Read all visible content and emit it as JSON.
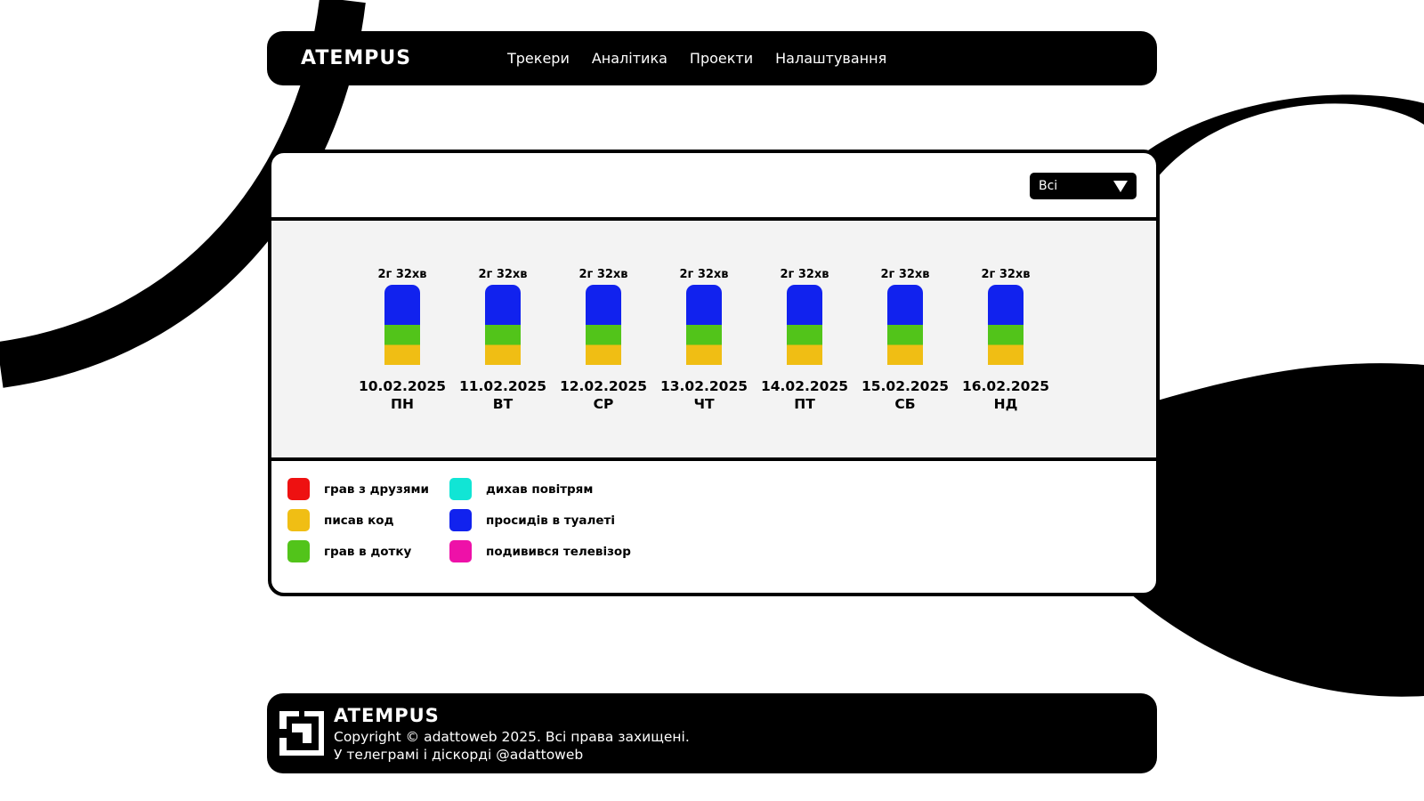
{
  "header": {
    "logo": "ATEMPUS",
    "nav": [
      "Трекери",
      "Аналітика",
      "Проекти",
      "Налаштування"
    ]
  },
  "filter": {
    "selected": "Всі"
  },
  "chart_data": {
    "type": "bar",
    "stacked": true,
    "categories": [
      "10.02.2025",
      "11.02.2025",
      "12.02.2025",
      "13.02.2025",
      "14.02.2025",
      "15.02.2025",
      "16.02.2025"
    ],
    "weekdays": [
      "ПН",
      "ВТ",
      "СР",
      "ЧТ",
      "ПТ",
      "СБ",
      "НД"
    ],
    "totals_labels": [
      "2г 32хв",
      "2г 32хв",
      "2г 32хв",
      "2г 32хв",
      "2г 32хв",
      "2г 32хв",
      "2г 32хв"
    ],
    "series": [
      {
        "name": "писав код",
        "color": "#F0BE14",
        "values": [
          0.25,
          0.25,
          0.25,
          0.25,
          0.25,
          0.25,
          0.25
        ]
      },
      {
        "name": "грав в дотку",
        "color": "#52C41A",
        "values": [
          0.25,
          0.25,
          0.25,
          0.25,
          0.25,
          0.25,
          0.25
        ]
      },
      {
        "name": "просидів в туалеті",
        "color": "#1122EE",
        "values": [
          0.5,
          0.5,
          0.5,
          0.5,
          0.5,
          0.5,
          0.5
        ]
      }
    ]
  },
  "legend": [
    {
      "label": "грав з друзями",
      "color": "#EE1111"
    },
    {
      "label": "писав код",
      "color": "#F0BE14"
    },
    {
      "label": "грав в дотку",
      "color": "#52C41A"
    },
    {
      "label": "дихав повітрям",
      "color": "#11E5D5"
    },
    {
      "label": "просидів в туалеті",
      "color": "#1122EE"
    },
    {
      "label": "подивився телевізор",
      "color": "#EE11A8"
    }
  ],
  "footer": {
    "brand": "ATEMPUS",
    "copyright": "Copyright © adattoweb 2025. Всі права захищені.",
    "contact": "У телеграмі і діскорді @adattoweb"
  }
}
